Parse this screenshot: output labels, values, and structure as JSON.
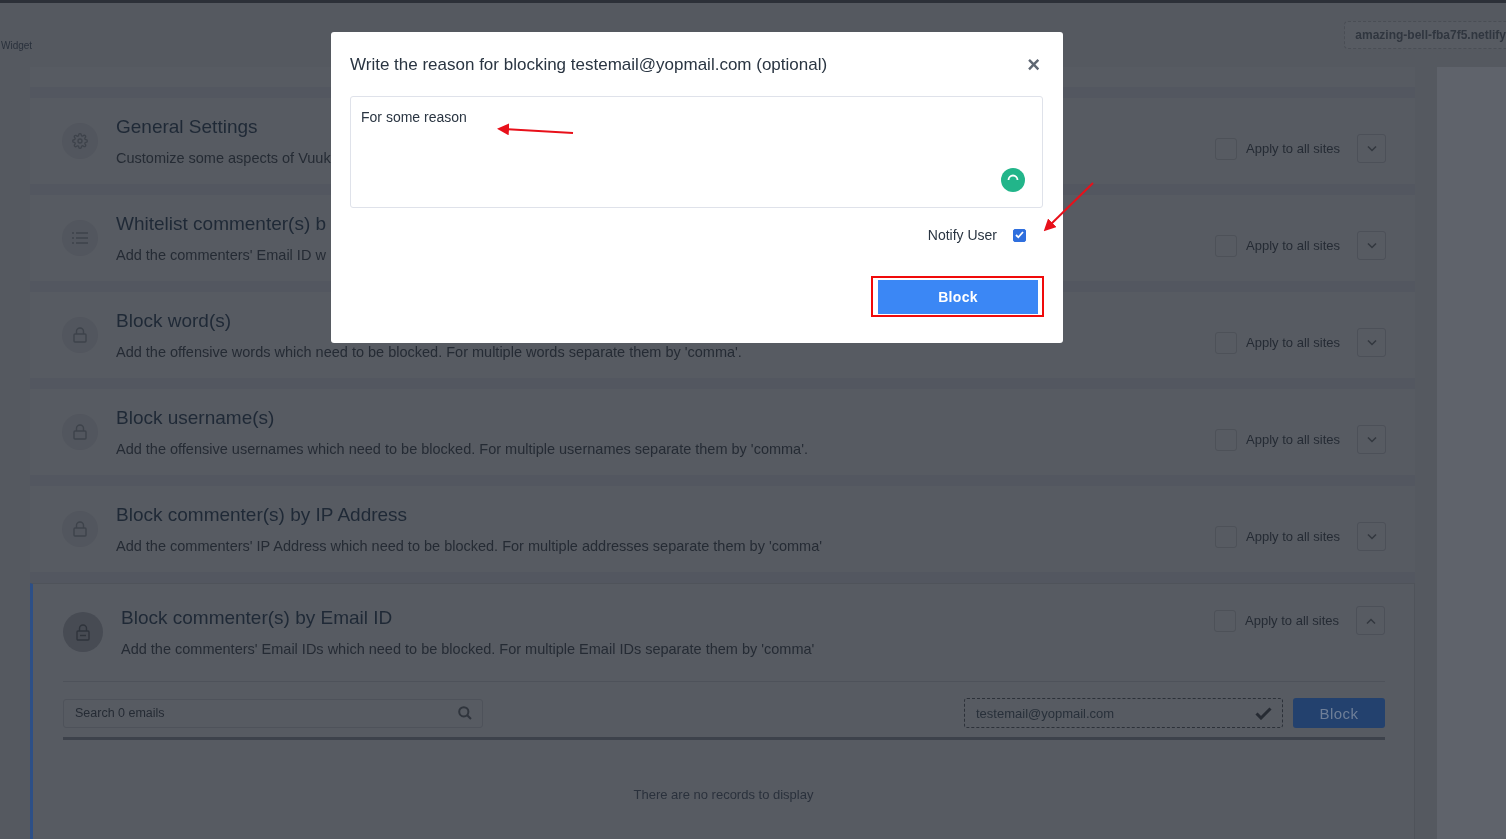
{
  "header": {
    "breadcrumb": "Widget",
    "site": "amazing-bell-fba7f5.netlify"
  },
  "sections": [
    {
      "kind": "gear",
      "title": "General Settings",
      "description": "Customize some aspects of Vuuk",
      "apply_label": "Apply to all sites",
      "apply_checked": false,
      "expanded": false
    },
    {
      "kind": "list",
      "title": "Whitelist commenter(s) b",
      "description": "Add the commenters' Email ID w",
      "apply_label": "Apply to all sites",
      "apply_checked": false,
      "expanded": false
    },
    {
      "kind": "lock",
      "title": "Block word(s)",
      "description": "Add the offensive words which need to be blocked. For multiple words separate them by 'comma'.",
      "apply_label": "Apply to all sites",
      "apply_checked": false,
      "expanded": false
    },
    {
      "kind": "lock",
      "title": "Block username(s)",
      "description": "Add the offensive usernames which need to be blocked. For multiple usernames separate them by 'comma'.",
      "apply_label": "Apply to all sites",
      "apply_checked": false,
      "expanded": false
    },
    {
      "kind": "lock",
      "title": "Block commenter(s) by IP Address",
      "description": "Add the commenters' IP Address which need to be blocked. For multiple addresses separate them by 'comma'",
      "apply_label": "Apply to all sites",
      "apply_checked": false,
      "expanded": false
    },
    {
      "kind": "lock-badge",
      "title": "Block commenter(s) by Email ID",
      "description": "Add the commenters' Email IDs which need to be blocked. For multiple Email IDs separate them by 'comma'",
      "apply_label": "Apply to all sites",
      "apply_checked": false,
      "expanded": true
    }
  ],
  "email_panel": {
    "search_placeholder": "Search 0 emails",
    "email_value": "testemail@yopmail.com",
    "block_label": "Block",
    "empty_text": "There are no records to display"
  },
  "dialog": {
    "title": "Write the reason for blocking testemail@yopmail.com (optional)",
    "close": "×",
    "reason_value": "For some reason",
    "notify_label": "Notify User",
    "notify_checked": true,
    "submit_label": "Block"
  }
}
